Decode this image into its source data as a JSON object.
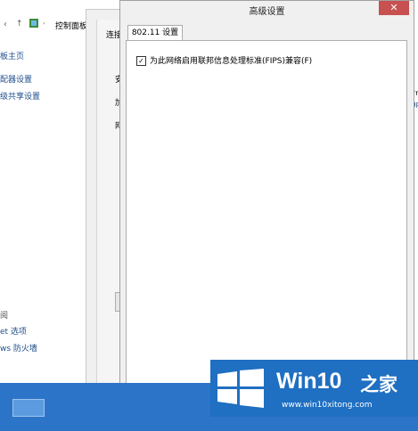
{
  "control_panel": {
    "nav_arrow": "↑",
    "breadcrumb": "控制面板",
    "sidebar": [
      "板主页",
      "配器设置",
      "级共享设置"
    ],
    "see_also": [
      "阅",
      "et 选项",
      "ws 防火墙"
    ],
    "right_edge": [
      "terr",
      "CUR"
    ]
  },
  "properties_window": {
    "tab_fragment": "连接",
    "labels": [
      "安",
      "加",
      "网"
    ]
  },
  "dialog": {
    "title": "高级设置",
    "close_glyph": "✕",
    "tab": "802.11 设置",
    "fips_checkbox_label": "为此网络启用联邦信息处理标准(FIPS)兼容(F)",
    "fips_checked": true
  },
  "watermark": {
    "brand": "Win10",
    "brand_suffix": "之家",
    "url": "www.win10xitong.com"
  }
}
